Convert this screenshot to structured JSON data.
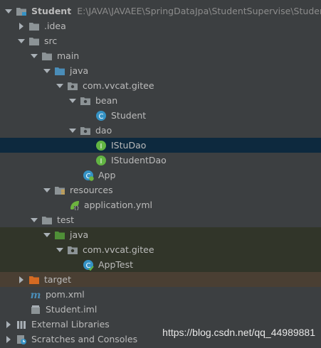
{
  "project": {
    "name": "Student",
    "path": "E:\\JAVA\\JAVAEE\\SpringDataJpa\\StudentSupervise\\Student"
  },
  "items": [
    {
      "label": ".idea"
    },
    {
      "label": "src"
    },
    {
      "label": "main"
    },
    {
      "label": "java"
    },
    {
      "label": "com.vvcat.gitee"
    },
    {
      "label": "bean"
    },
    {
      "label": "Student"
    },
    {
      "label": "dao"
    },
    {
      "label": "IStuDao"
    },
    {
      "label": "IStudentDao"
    },
    {
      "label": "App"
    },
    {
      "label": "resources"
    },
    {
      "label": "application.yml"
    },
    {
      "label": "test"
    },
    {
      "label": "java"
    },
    {
      "label": "com.vvcat.gitee"
    },
    {
      "label": "AppTest"
    },
    {
      "label": "target"
    },
    {
      "label": "pom.xml"
    },
    {
      "label": "Student.iml"
    },
    {
      "label": "External Libraries"
    },
    {
      "label": "Scratches and Consoles"
    }
  ],
  "watermark": "https://blog.csdn.net/qq_44989881",
  "colors": {
    "background": "#3c3f41",
    "selection": "#0d293e",
    "test_zone": "#313529",
    "excluded": "#4a3f33",
    "folder": "#8c9396",
    "source_folder": "#4a8db8",
    "test_folder": "#4f8f37",
    "target_folder": "#d46a22",
    "class": "#3592c4",
    "interface": "#62b543"
  }
}
